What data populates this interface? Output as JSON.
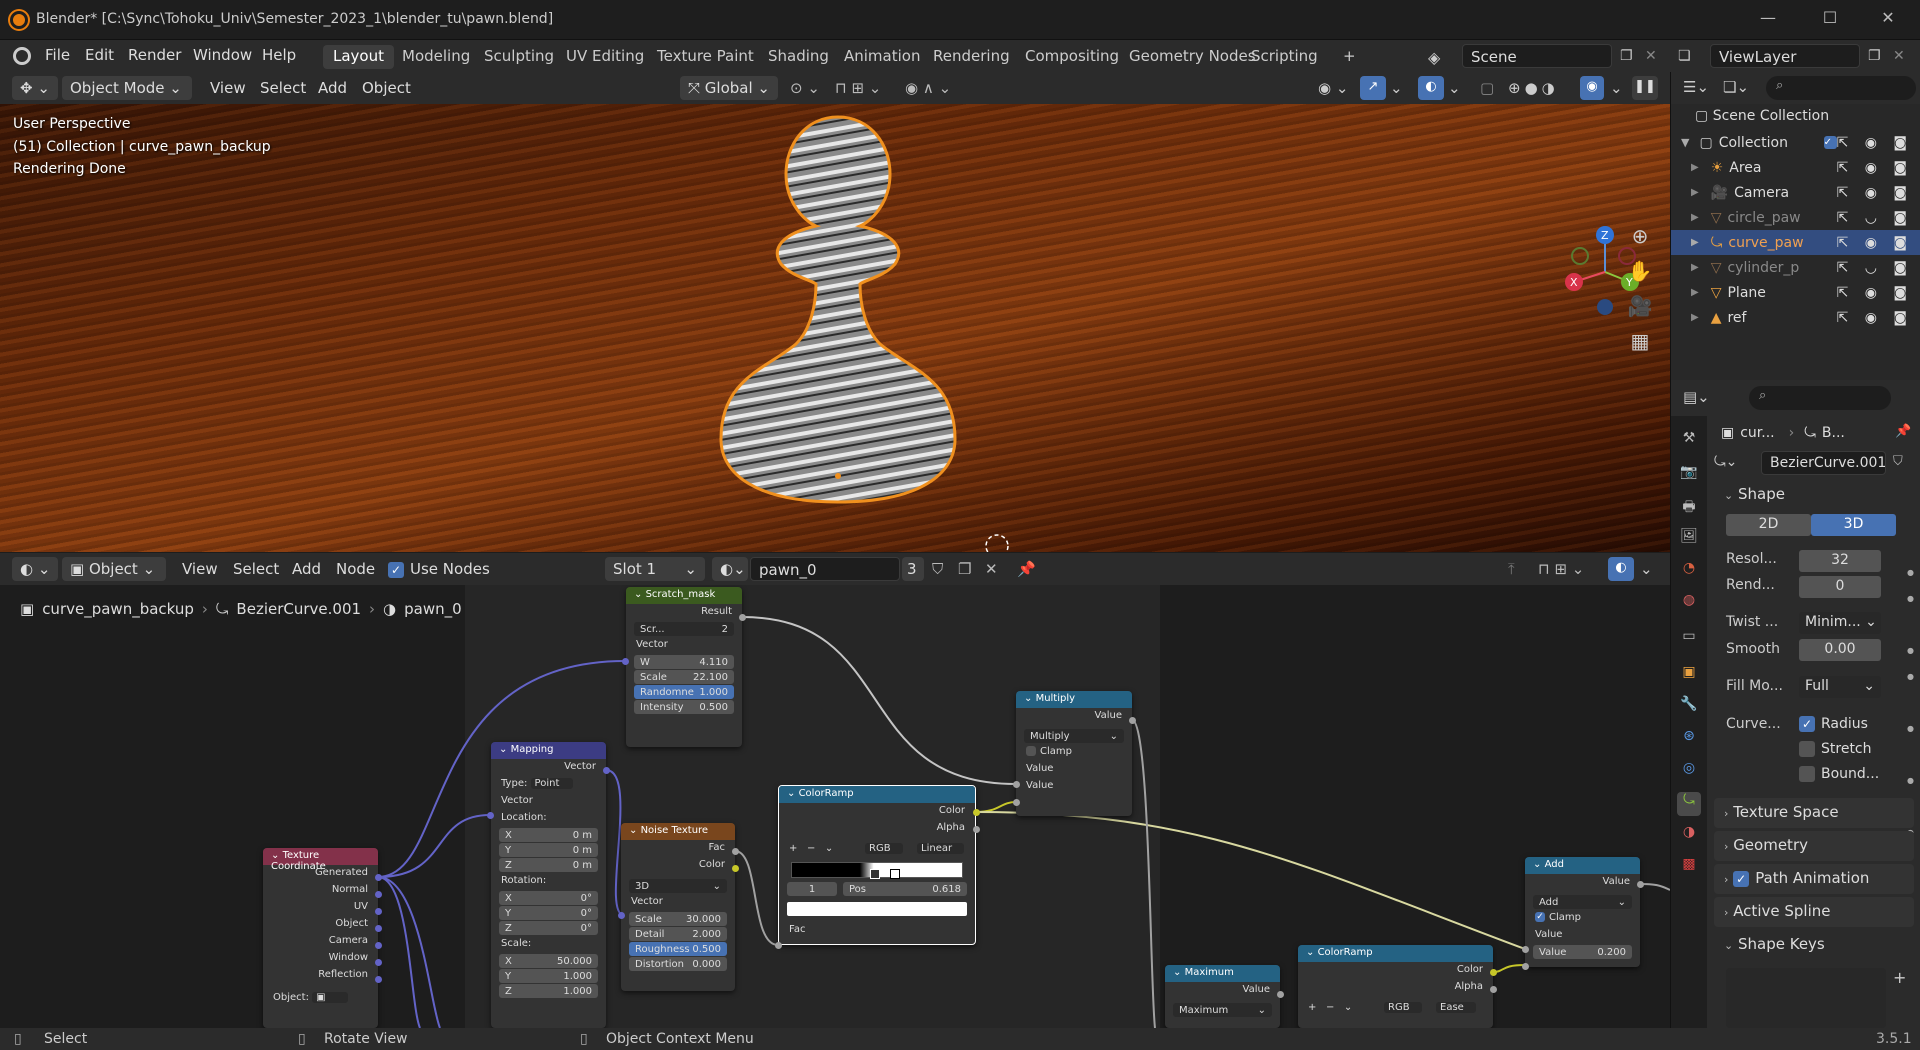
{
  "window": {
    "title": "Blender* [C:\\Sync\\Tohoku_Univ\\Semester_2023_1\\blender_tu\\pawn.blend]",
    "min": "—",
    "max": "☐",
    "close": "✕"
  },
  "menus": [
    "File",
    "Edit",
    "Render",
    "Window",
    "Help"
  ],
  "workspaces": [
    "Layout",
    "Modeling",
    "Sculpting",
    "UV Editing",
    "Texture Paint",
    "Shading",
    "Animation",
    "Rendering",
    "Compositing",
    "Geometry Nodes",
    "Scripting",
    "+"
  ],
  "scene": "Scene",
  "view_layer": "ViewLayer",
  "viewport_header": {
    "mode": "Object Mode",
    "items": [
      "View",
      "Select",
      "Add",
      "Object"
    ],
    "transform": "Global"
  },
  "viewport": {
    "overlay": [
      "User Perspective",
      "(51) Collection | curve_pawn_backup",
      "Rendering Done"
    ],
    "axes": {
      "z": "Z",
      "y": "Y",
      "x": "X"
    }
  },
  "node_header": {
    "editor": "Object",
    "items": [
      "View",
      "Select",
      "Add",
      "Node"
    ],
    "use_nodes": "Use Nodes",
    "slot": "Slot 1",
    "material": "pawn_0",
    "users": "3"
  },
  "breadcrumb": {
    "object": "curve_pawn_backup",
    "data": "BezierCurve.001",
    "material": "pawn_0"
  },
  "nodes": {
    "scratch": {
      "title": "Scratch_mask",
      "result": "Result",
      "img": "Scr...",
      "num": "2",
      "vector": "Vector",
      "w_l": "W",
      "w": "4.110",
      "scale_l": "Scale",
      "scale": "22.100",
      "rand_l": "Randomne",
      "rand": "1.000",
      "int_l": "Intensity",
      "int": "0.500"
    },
    "mapping": {
      "title": "Mapping",
      "vector_out": "Vector",
      "type_l": "Type:",
      "type": "Point",
      "vector_in": "Vector",
      "loc": "Location:",
      "lx": "0 m",
      "ly": "0 m",
      "lz": "0 m",
      "rot": "Rotation:",
      "rx": "0°",
      "ry": "0°",
      "rz": "0°",
      "scl": "Scale:",
      "sx": "50.000",
      "sy": "1.000",
      "sz": "1.000",
      "X": "X",
      "Y": "Y",
      "Z": "Z"
    },
    "texcoord": {
      "title": "Texture Coordinate",
      "outs": [
        "Generated",
        "Normal",
        "UV",
        "Object",
        "Camera",
        "Window",
        "Reflection"
      ],
      "object_l": "Object:"
    },
    "noise": {
      "title": "Noise Texture",
      "fac": "Fac",
      "color": "Color",
      "dim": "3D",
      "vector": "Vector",
      "scale_l": "Scale",
      "scale": "30.000",
      "detail_l": "Detail",
      "detail": "2.000",
      "rough_l": "Roughness",
      "rough": "0.500",
      "dist_l": "Distortion",
      "dist": "0.000"
    },
    "colorramp": {
      "title": "ColorRamp",
      "color": "Color",
      "alpha": "Alpha",
      "plus": "+",
      "minus": "−",
      "chev": "⌄",
      "mode": "RGB",
      "interp": "Linear",
      "idx": "1",
      "pos_l": "Pos",
      "pos": "0.618",
      "fac": "Fac"
    },
    "multiply": {
      "title": "Multiply",
      "value": "Value",
      "op": "Multiply",
      "clamp": "Clamp",
      "in1": "Value",
      "in2": "Value"
    },
    "add": {
      "title": "Add",
      "value": "Value",
      "op": "Add",
      "clamp": "Clamp",
      "in1": "Value",
      "in2_l": "Value",
      "in2": "0.200"
    },
    "maximum": {
      "title": "Maximum",
      "value": "Value",
      "op": "Maximum"
    },
    "colorramp2": {
      "title": "ColorRamp",
      "color": "Color",
      "alpha": "Alpha",
      "plus": "+",
      "minus": "−",
      "chev": "⌄",
      "mode": "RGB",
      "interp": "Ease"
    }
  },
  "outliner": {
    "root": "Scene Collection",
    "collection": "Collection",
    "items": [
      {
        "name": "Area",
        "icon_color": "#e8a040"
      },
      {
        "name": "Camera",
        "icon_color": "#e8a040"
      },
      {
        "name": "circle_paw",
        "icon_color": "#7a6a5a"
      },
      {
        "name": "curve_paw",
        "icon_color": "#e8a040"
      },
      {
        "name": "cylinder_p",
        "icon_color": "#7a6a5a"
      },
      {
        "name": "Plane",
        "icon_color": "#e8a040"
      },
      {
        "name": "ref",
        "icon_color": "#e8a040"
      }
    ]
  },
  "properties": {
    "crumb_obj": "cur...",
    "crumb_data": "B...",
    "datablock": "BezierCurve.001",
    "shape": "Shape",
    "b2d": "2D",
    "b3d": "3D",
    "res_l": "Resol...",
    "res": "32",
    "rend_l": "Rend...",
    "rend": "0",
    "twist_l": "Twist ...",
    "twist": "Minim...",
    "smooth_l": "Smooth",
    "smooth": "0.00",
    "fill_l": "Fill Mo...",
    "fill": "Full",
    "curve_l": "Curve...",
    "radius": "Radius",
    "stretch": "Stretch",
    "bound": "Bound...",
    "sections": [
      "Texture Space",
      "Geometry",
      "Path Animation",
      "Active Spline",
      "Shape Keys"
    ]
  },
  "status": {
    "select": "Select",
    "rotate": "Rotate View",
    "ctx": "Object Context Menu",
    "version": "3.5.1"
  },
  "colors": {
    "accent": "#4772b3",
    "selection": "#e87d0d",
    "node_vector_header": "#3c3c83",
    "node_texture_header": "#79461d",
    "node_converter_header": "#246283",
    "node_input_header": "#83314a",
    "node_group_header": "#3b5a1f"
  }
}
